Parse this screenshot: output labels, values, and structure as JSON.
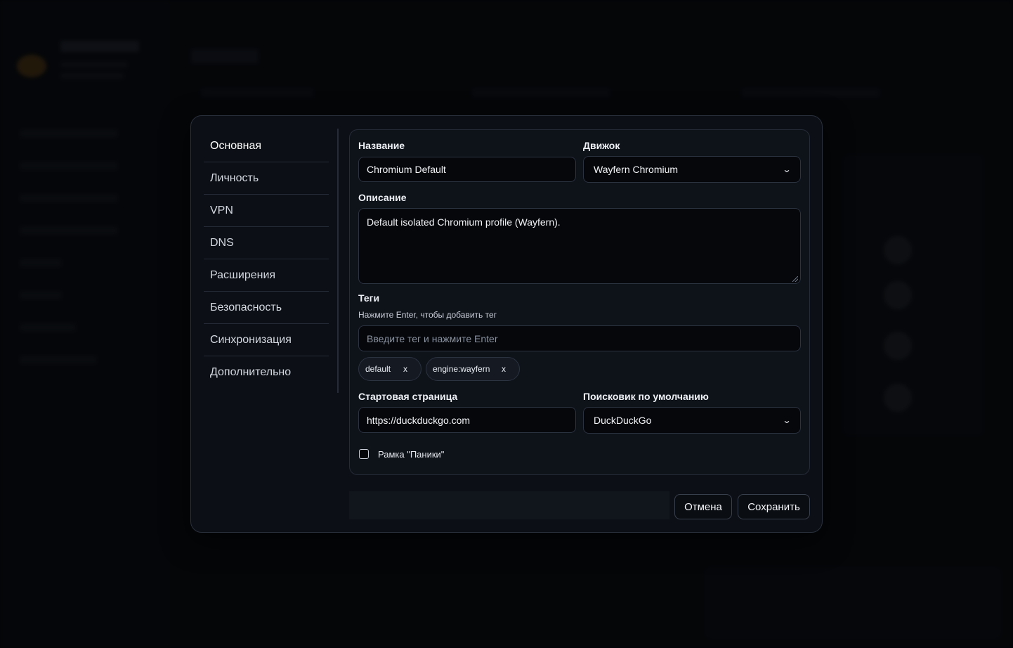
{
  "nav": {
    "items": [
      {
        "label": "Основная"
      },
      {
        "label": "Личность"
      },
      {
        "label": "VPN"
      },
      {
        "label": "DNS"
      },
      {
        "label": "Расширения"
      },
      {
        "label": "Безопасность"
      },
      {
        "label": "Синхронизация"
      },
      {
        "label": "Дополнительно"
      }
    ]
  },
  "form": {
    "name_label": "Название",
    "name_value": "Chromium Default",
    "engine_label": "Движок",
    "engine_value": "Wayfern Chromium",
    "description_label": "Описание",
    "description_value": "Default isolated Chromium profile (Wayfern).",
    "tags_label": "Теги",
    "tags_hint": "Нажмите Enter, чтобы добавить тег",
    "tags_placeholder": "Введите тег и нажмите Enter",
    "tags": [
      {
        "label": "default",
        "remove": "x"
      },
      {
        "label": "engine:wayfern",
        "remove": "x"
      }
    ],
    "start_page_label": "Стартовая страница",
    "start_page_value": "https://duckduckgo.com",
    "search_engine_label": "Поисковик по умолчанию",
    "search_engine_value": "DuckDuckGo",
    "panic_frame_label": "Рамка \"Паники\""
  },
  "buttons": {
    "cancel": "Отмена",
    "save": "Сохранить"
  },
  "icons": {
    "select_chevron": "chevron-down-icon",
    "tag_remove": "close-icon"
  }
}
